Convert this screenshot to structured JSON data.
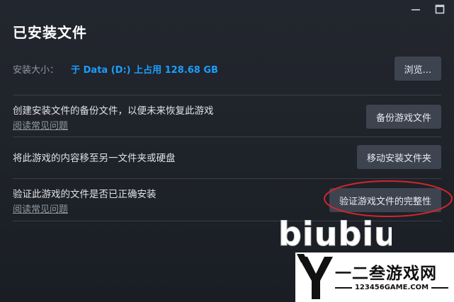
{
  "window": {
    "title": "已安装文件",
    "controls": [
      "minimize-icon",
      "maximize-icon"
    ]
  },
  "install_size": {
    "label": "安装大小：",
    "value": "于 Data (D:) 上占用 128.68 GB",
    "browse_button": "浏览..."
  },
  "rows": [
    {
      "description": "创建安装文件的备份文件，以便未来恢复此游戏",
      "link": "阅读常见问题",
      "button": "备份游戏文件"
    },
    {
      "description": "将此游戏的内容移至另一文件夹或硬盘",
      "button": "移动安装文件夹"
    },
    {
      "description": "验证此游戏的文件是否已正确安装",
      "link": "阅读常见问题",
      "button": "验证游戏文件的完整性"
    }
  ],
  "watermark": {
    "text": "biubiu"
  },
  "site_logo": {
    "letter": "Y",
    "title": "一二叁游戏网",
    "url": "123456GAME.COM"
  },
  "colors": {
    "background": "#1f232a",
    "accent_blue": "#1a9fff",
    "button_bg": "#3d4450",
    "annotation_red": "#d3262b"
  }
}
